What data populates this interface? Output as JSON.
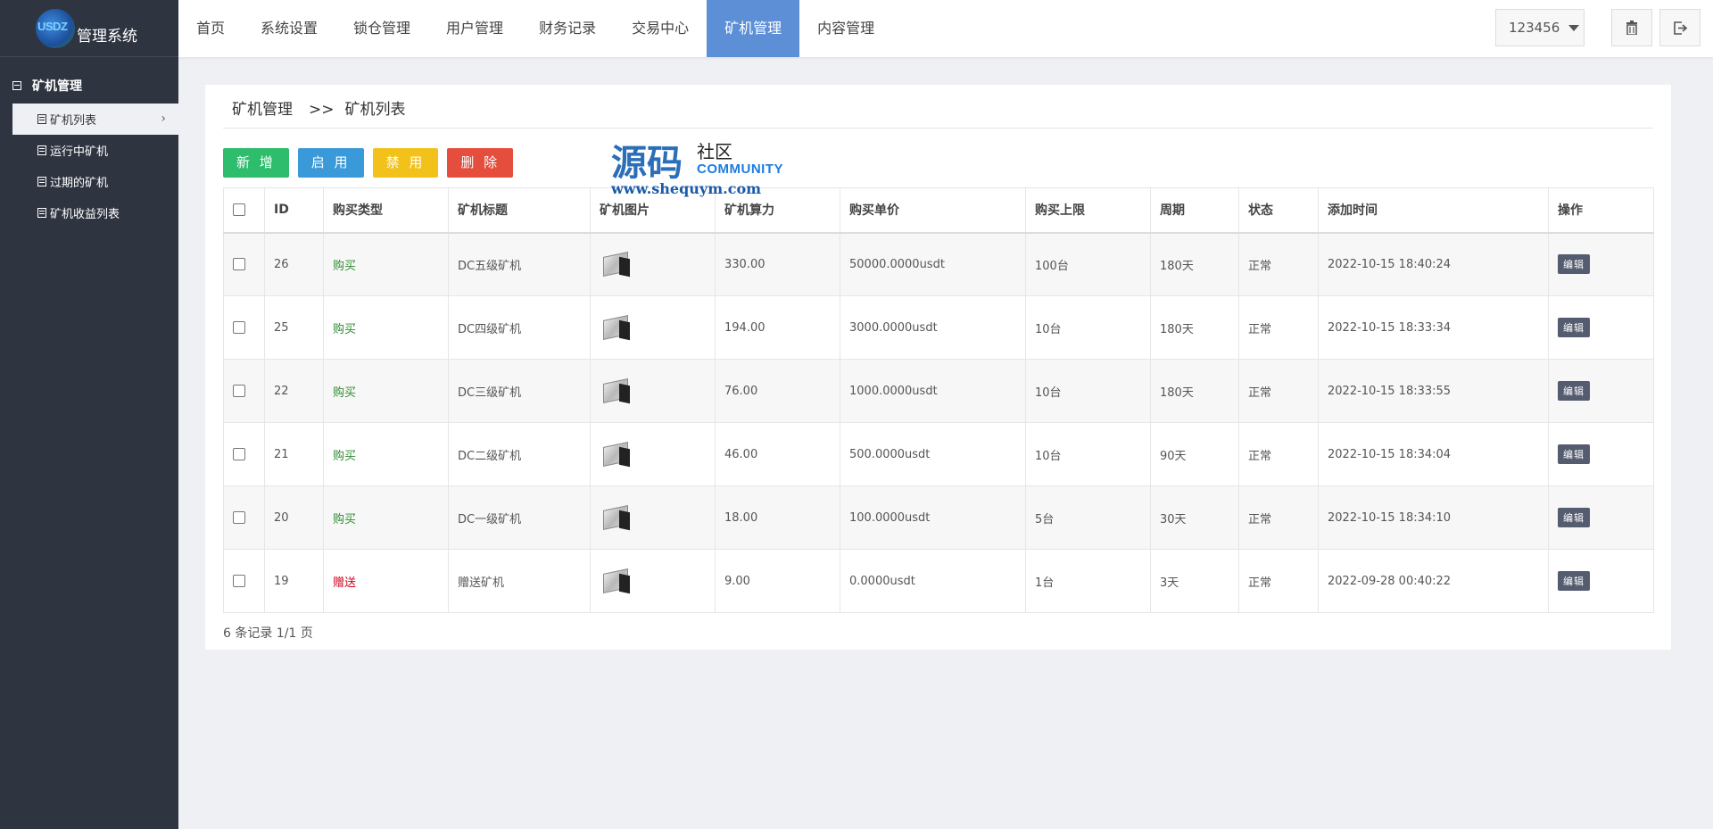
{
  "logo": {
    "mark_text": "USDZ",
    "title": "管理系统"
  },
  "sidebar": {
    "group_label": "矿机管理",
    "items": [
      {
        "label": "矿机列表",
        "active": true
      },
      {
        "label": "运行中矿机"
      },
      {
        "label": "过期的矿机"
      },
      {
        "label": "矿机收益列表"
      }
    ]
  },
  "topnav": {
    "items": [
      "首页",
      "系统设置",
      "锁仓管理",
      "用户管理",
      "财务记录",
      "交易中心",
      "矿机管理",
      "内容管理"
    ],
    "active_index": 6,
    "user": "123456"
  },
  "breadcrumb": {
    "parent": "矿机管理",
    "separator": ">>",
    "current": "矿机列表"
  },
  "toolbar": {
    "add": "新 增",
    "enable": "启 用",
    "disable": "禁 用",
    "delete": "删 除"
  },
  "watermark": {
    "big": "源码",
    "small": "社区",
    "community": "COMMUNITY",
    "url": "www.shequym.com"
  },
  "table": {
    "headers": [
      "ID",
      "购买类型",
      "矿机标题",
      "矿机图片",
      "矿机算力",
      "购买单价",
      "购买上限",
      "周期",
      "状态",
      "添加时间",
      "操作"
    ],
    "rows": [
      {
        "id": "26",
        "type": "购买",
        "title": "DC五级矿机",
        "power": "330.00",
        "price": "50000.0000usdt",
        "limit": "100台",
        "period": "180天",
        "status": "正常",
        "time": "2022-10-15 18:40:24",
        "action": "编辑"
      },
      {
        "id": "25",
        "type": "购买",
        "title": "DC四级矿机",
        "power": "194.00",
        "price": "3000.0000usdt",
        "limit": "10台",
        "period": "180天",
        "status": "正常",
        "time": "2022-10-15 18:33:34",
        "action": "编辑"
      },
      {
        "id": "22",
        "type": "购买",
        "title": "DC三级矿机",
        "power": "76.00",
        "price": "1000.0000usdt",
        "limit": "10台",
        "period": "180天",
        "status": "正常",
        "time": "2022-10-15 18:33:55",
        "action": "编辑"
      },
      {
        "id": "21",
        "type": "购买",
        "title": "DC二级矿机",
        "power": "46.00",
        "price": "500.0000usdt",
        "limit": "10台",
        "period": "90天",
        "status": "正常",
        "time": "2022-10-15 18:34:04",
        "action": "编辑"
      },
      {
        "id": "20",
        "type": "购买",
        "title": "DC一级矿机",
        "power": "18.00",
        "price": "100.0000usdt",
        "limit": "5台",
        "period": "30天",
        "status": "正常",
        "time": "2022-10-15 18:34:10",
        "action": "编辑"
      },
      {
        "id": "19",
        "type": "赠送",
        "title": "赠送矿机",
        "power": "9.00",
        "price": "0.0000usdt",
        "limit": "1台",
        "period": "3天",
        "status": "正常",
        "time": "2022-09-28 00:40:22",
        "action": "编辑"
      }
    ]
  },
  "pagination_text": "6 条记录 1/1 页",
  "colors": {
    "sidebar_bg": "#2f3441",
    "nav_active": "#5c8fd6",
    "buy": "#2e8b2e",
    "gift": "#d0021b"
  },
  "icons": {
    "menu_group": "minus-square-icon",
    "menu_item": "list-icon",
    "trash": "trash-icon",
    "exit": "logout-icon"
  }
}
